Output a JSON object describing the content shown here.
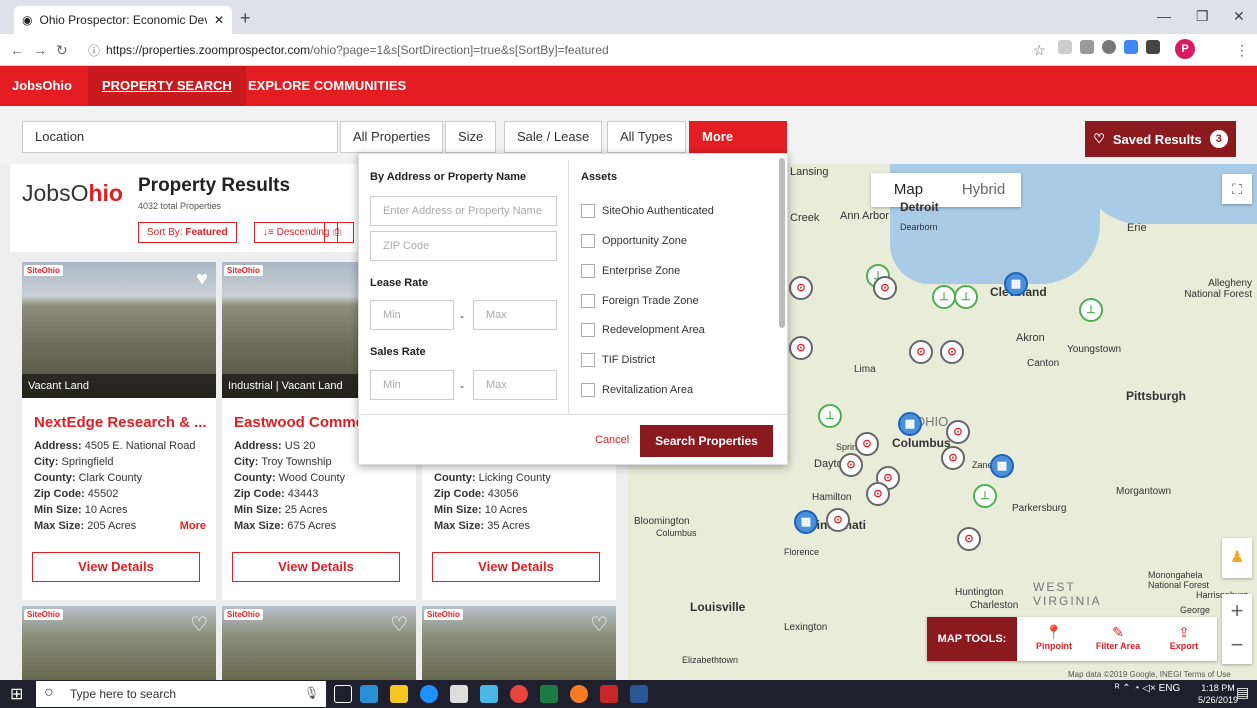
{
  "browser": {
    "tab_title": "Ohio Prospector: Economic Deve",
    "url_host": "https://properties.zoomprospector.com",
    "url_path": "/ohio?page=1&s[SortDirection]=true&s[SortBy]=featured",
    "profile_initial": "P"
  },
  "site_nav": {
    "brand": "JobsOhio",
    "property_search": "PROPERTY SEARCH",
    "explore": "EXPLORE COMMUNITIES"
  },
  "filters": {
    "location": "Location",
    "all_properties": "All Properties",
    "size": "Size",
    "sale_lease": "Sale / Lease",
    "all_types": "All Types",
    "more_filters": "More Filters",
    "saved_results": "Saved Results",
    "saved_count": "3"
  },
  "results": {
    "logo_a": "JobsO",
    "logo_b": "hio",
    "title": "Property Results",
    "total": "4032 total Properties",
    "sort_label": "Sort By:",
    "sort_value": "Featured",
    "direction": "Descending"
  },
  "cards": [
    {
      "badge": "SiteOhio",
      "tag": "Vacant Land",
      "name": "NextEdge Research & ...",
      "address": "4505 E. National Road",
      "city": "Springfield",
      "county": "Clark County",
      "zip": "45502",
      "min": "10 Acres",
      "max": "205 Acres",
      "more": "More",
      "button": "View Details"
    },
    {
      "badge": "SiteOhio",
      "tag": "Industrial | Vacant Land",
      "name": "Eastwood Comme",
      "address": "US 20",
      "city": "Troy Township",
      "county": "Wood County",
      "zip": "43443",
      "min": "25 Acres",
      "max": "675 Acres",
      "button": "View Details"
    },
    {
      "badge": "SiteOhio",
      "tag": "",
      "name": "",
      "address": "",
      "city": "",
      "county": "Licking County",
      "zip": "43056",
      "min": "10 Acres",
      "max": "35 Acres",
      "button": "View Details"
    }
  ],
  "labels": {
    "address": "Address:",
    "city": "City:",
    "county": "County:",
    "zip": "Zip Code:",
    "min": "Min Size:",
    "max": "Max Size:"
  },
  "dropdown": {
    "by_address": "By Address or Property Name",
    "address_placeholder": "Enter Address or Property Name",
    "zip_placeholder": "ZIP Code",
    "lease_rate": "Lease Rate",
    "sales_rate": "Sales Rate",
    "min": "Min",
    "max": "Max",
    "dash": "-",
    "assets": "Assets",
    "asset_items": [
      "SiteOhio Authenticated",
      "Opportunity Zone",
      "Enterprise Zone",
      "Foreign Trade Zone",
      "Redevelopment Area",
      "TIF District",
      "Revitalization Area"
    ],
    "cancel": "Cancel",
    "search": "Search Properties"
  },
  "map": {
    "map_btn": "Map",
    "hybrid_btn": "Hybrid",
    "tools_label": "MAP TOOLS:",
    "pinpoint": "Pinpoint",
    "filter_area": "Filter Area",
    "export": "Export",
    "copyright": "Map data ©2019 Google, INEGI   Terms of Use",
    "places": [
      "Lansing",
      "Detroit",
      "Ann Arbor",
      "Dearborn",
      "Creek",
      "Erie",
      "Allegheny National Forest",
      "Cleveland",
      "Akron",
      "Youngstown",
      "Canton",
      "Lima",
      "Pittsburgh",
      "OHIO",
      "Columbus",
      "Dayton",
      "Zanesville",
      "Hamilton",
      "Cincinnati",
      "Parkersburg",
      "Morgantown",
      "Bloomington",
      "Columbus",
      "Florence",
      "Huntington",
      "Charleston",
      "WEST VIRGINIA",
      "Monongahela National Forest",
      "Harrisonburg",
      "George",
      "Louisville",
      "Lexington",
      "Elizabethtown",
      "Springfield"
    ]
  },
  "taskbar": {
    "search": "Type here to search",
    "lang": "ENG",
    "time": "1:18 PM",
    "date": "5/26/2019"
  }
}
